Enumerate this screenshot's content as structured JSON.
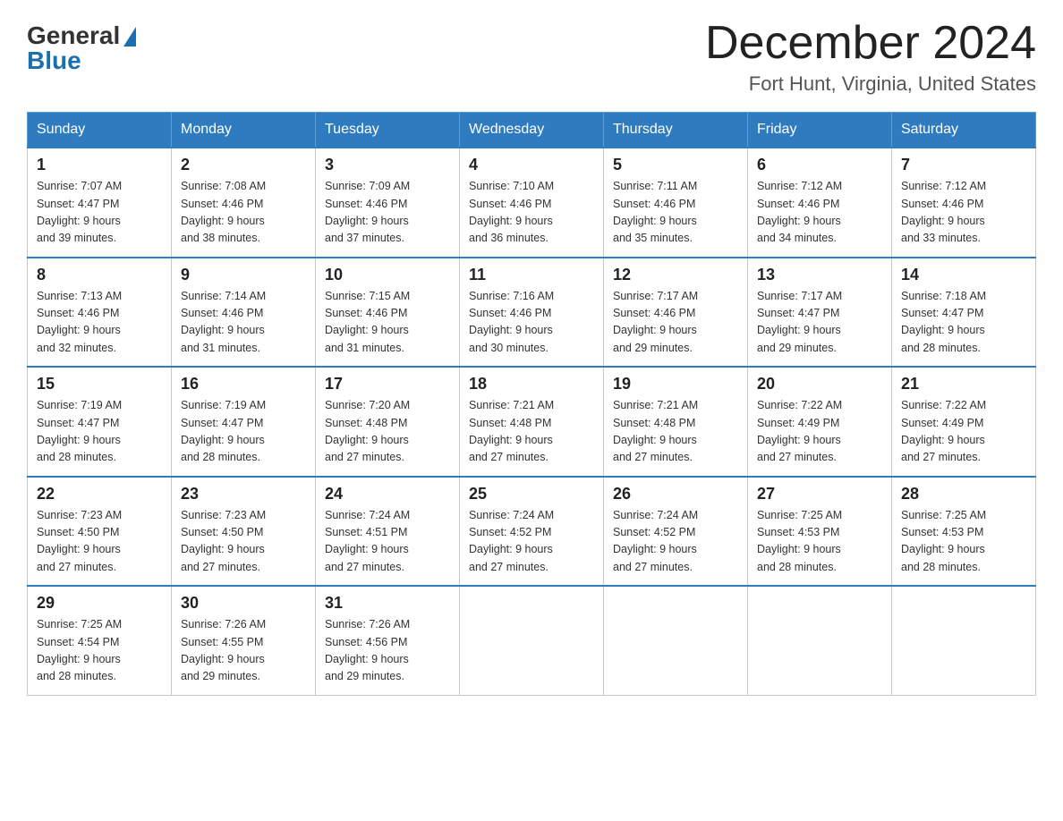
{
  "header": {
    "logo_general": "General",
    "logo_blue": "Blue",
    "month_title": "December 2024",
    "location": "Fort Hunt, Virginia, United States"
  },
  "weekdays": [
    "Sunday",
    "Monday",
    "Tuesday",
    "Wednesday",
    "Thursday",
    "Friday",
    "Saturday"
  ],
  "weeks": [
    [
      {
        "day": "1",
        "sunrise": "7:07 AM",
        "sunset": "4:47 PM",
        "daylight": "9 hours and 39 minutes."
      },
      {
        "day": "2",
        "sunrise": "7:08 AM",
        "sunset": "4:46 PM",
        "daylight": "9 hours and 38 minutes."
      },
      {
        "day": "3",
        "sunrise": "7:09 AM",
        "sunset": "4:46 PM",
        "daylight": "9 hours and 37 minutes."
      },
      {
        "day": "4",
        "sunrise": "7:10 AM",
        "sunset": "4:46 PM",
        "daylight": "9 hours and 36 minutes."
      },
      {
        "day": "5",
        "sunrise": "7:11 AM",
        "sunset": "4:46 PM",
        "daylight": "9 hours and 35 minutes."
      },
      {
        "day": "6",
        "sunrise": "7:12 AM",
        "sunset": "4:46 PM",
        "daylight": "9 hours and 34 minutes."
      },
      {
        "day": "7",
        "sunrise": "7:12 AM",
        "sunset": "4:46 PM",
        "daylight": "9 hours and 33 minutes."
      }
    ],
    [
      {
        "day": "8",
        "sunrise": "7:13 AM",
        "sunset": "4:46 PM",
        "daylight": "9 hours and 32 minutes."
      },
      {
        "day": "9",
        "sunrise": "7:14 AM",
        "sunset": "4:46 PM",
        "daylight": "9 hours and 31 minutes."
      },
      {
        "day": "10",
        "sunrise": "7:15 AM",
        "sunset": "4:46 PM",
        "daylight": "9 hours and 31 minutes."
      },
      {
        "day": "11",
        "sunrise": "7:16 AM",
        "sunset": "4:46 PM",
        "daylight": "9 hours and 30 minutes."
      },
      {
        "day": "12",
        "sunrise": "7:17 AM",
        "sunset": "4:46 PM",
        "daylight": "9 hours and 29 minutes."
      },
      {
        "day": "13",
        "sunrise": "7:17 AM",
        "sunset": "4:47 PM",
        "daylight": "9 hours and 29 minutes."
      },
      {
        "day": "14",
        "sunrise": "7:18 AM",
        "sunset": "4:47 PM",
        "daylight": "9 hours and 28 minutes."
      }
    ],
    [
      {
        "day": "15",
        "sunrise": "7:19 AM",
        "sunset": "4:47 PM",
        "daylight": "9 hours and 28 minutes."
      },
      {
        "day": "16",
        "sunrise": "7:19 AM",
        "sunset": "4:47 PM",
        "daylight": "9 hours and 28 minutes."
      },
      {
        "day": "17",
        "sunrise": "7:20 AM",
        "sunset": "4:48 PM",
        "daylight": "9 hours and 27 minutes."
      },
      {
        "day": "18",
        "sunrise": "7:21 AM",
        "sunset": "4:48 PM",
        "daylight": "9 hours and 27 minutes."
      },
      {
        "day": "19",
        "sunrise": "7:21 AM",
        "sunset": "4:48 PM",
        "daylight": "9 hours and 27 minutes."
      },
      {
        "day": "20",
        "sunrise": "7:22 AM",
        "sunset": "4:49 PM",
        "daylight": "9 hours and 27 minutes."
      },
      {
        "day": "21",
        "sunrise": "7:22 AM",
        "sunset": "4:49 PM",
        "daylight": "9 hours and 27 minutes."
      }
    ],
    [
      {
        "day": "22",
        "sunrise": "7:23 AM",
        "sunset": "4:50 PM",
        "daylight": "9 hours and 27 minutes."
      },
      {
        "day": "23",
        "sunrise": "7:23 AM",
        "sunset": "4:50 PM",
        "daylight": "9 hours and 27 minutes."
      },
      {
        "day": "24",
        "sunrise": "7:24 AM",
        "sunset": "4:51 PM",
        "daylight": "9 hours and 27 minutes."
      },
      {
        "day": "25",
        "sunrise": "7:24 AM",
        "sunset": "4:52 PM",
        "daylight": "9 hours and 27 minutes."
      },
      {
        "day": "26",
        "sunrise": "7:24 AM",
        "sunset": "4:52 PM",
        "daylight": "9 hours and 27 minutes."
      },
      {
        "day": "27",
        "sunrise": "7:25 AM",
        "sunset": "4:53 PM",
        "daylight": "9 hours and 28 minutes."
      },
      {
        "day": "28",
        "sunrise": "7:25 AM",
        "sunset": "4:53 PM",
        "daylight": "9 hours and 28 minutes."
      }
    ],
    [
      {
        "day": "29",
        "sunrise": "7:25 AM",
        "sunset": "4:54 PM",
        "daylight": "9 hours and 28 minutes."
      },
      {
        "day": "30",
        "sunrise": "7:26 AM",
        "sunset": "4:55 PM",
        "daylight": "9 hours and 29 minutes."
      },
      {
        "day": "31",
        "sunrise": "7:26 AM",
        "sunset": "4:56 PM",
        "daylight": "9 hours and 29 minutes."
      },
      null,
      null,
      null,
      null
    ]
  ],
  "labels": {
    "sunrise": "Sunrise:",
    "sunset": "Sunset:",
    "daylight": "Daylight:"
  }
}
